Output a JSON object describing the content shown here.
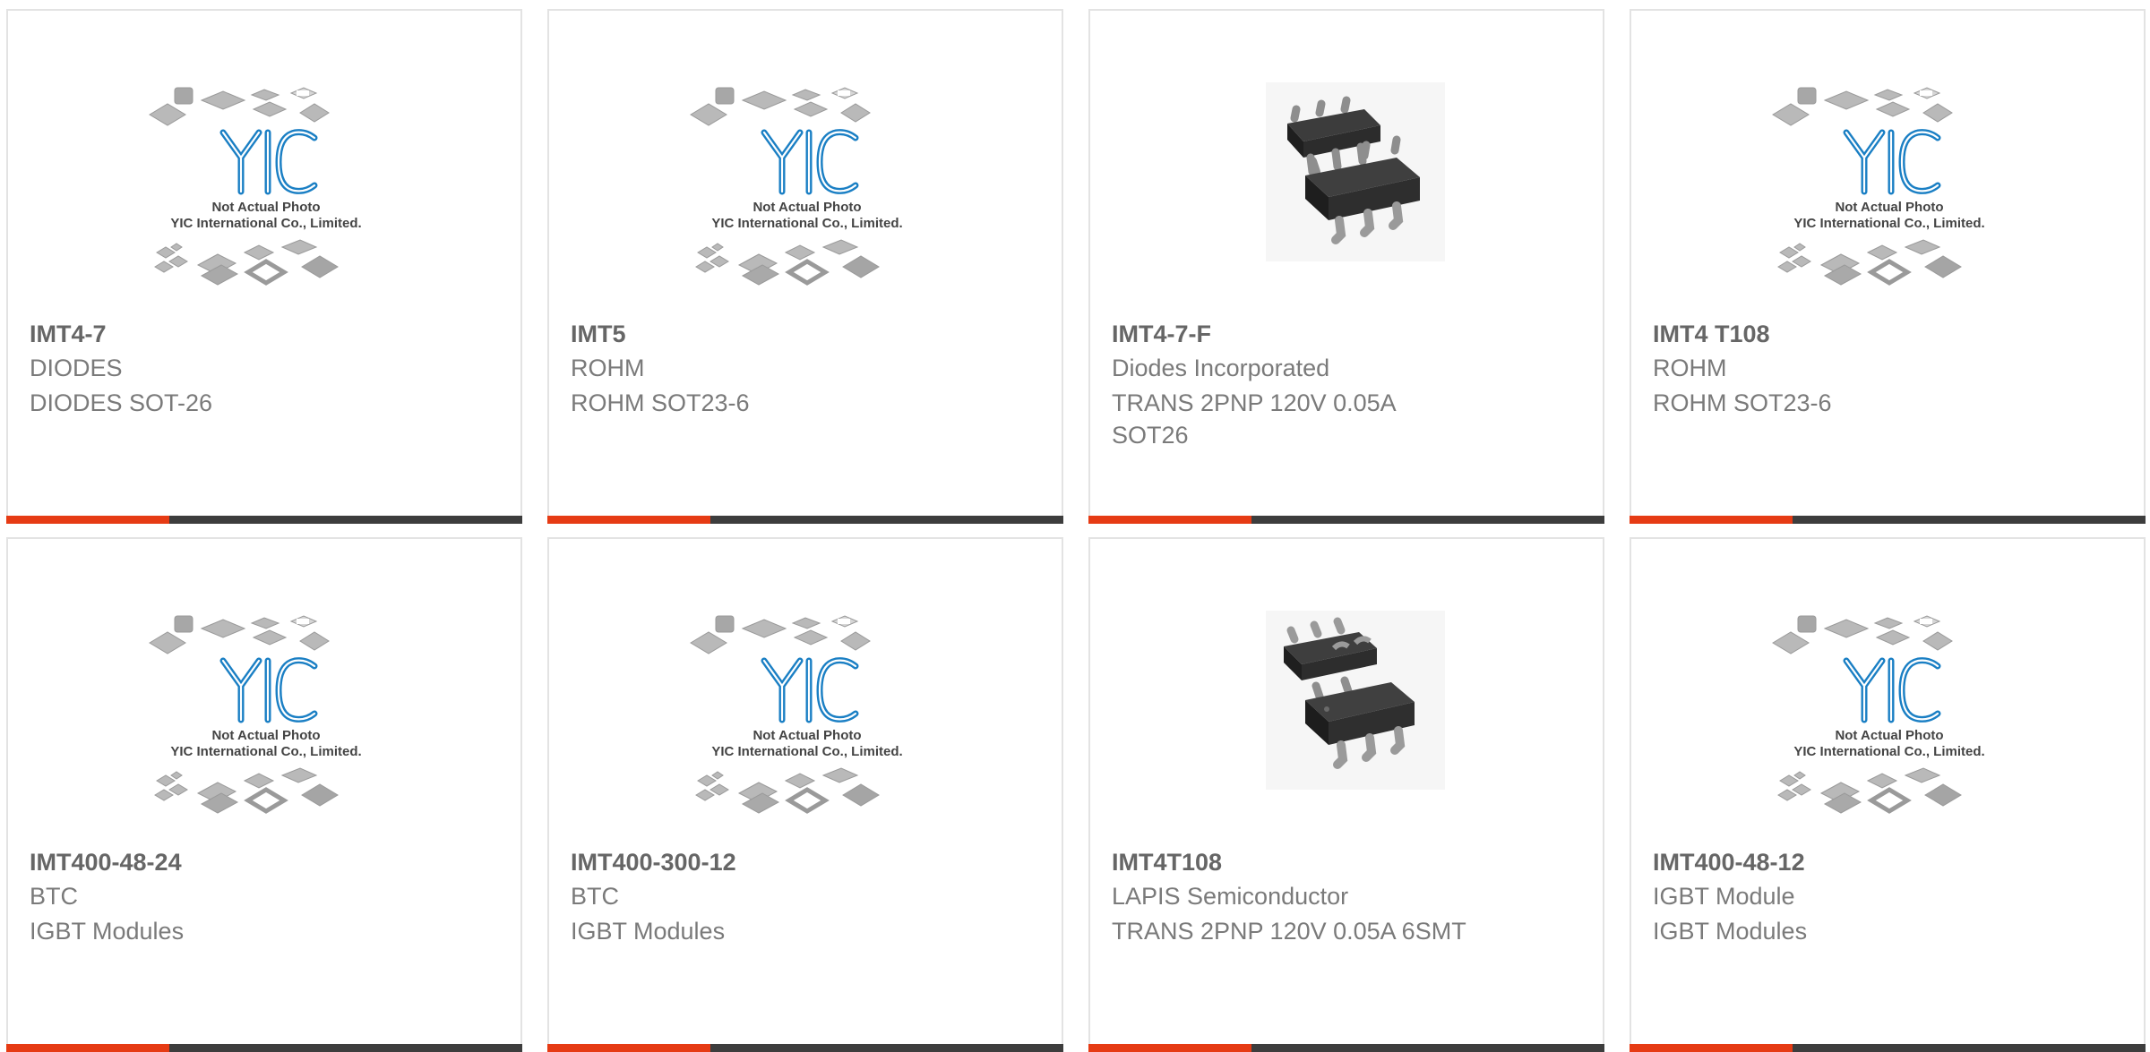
{
  "products": [
    {
      "part": "IMT4-7",
      "maker": "DIODES",
      "desc": "DIODES SOT-26",
      "photo": "placeholder"
    },
    {
      "part": "IMT5",
      "maker": "ROHM",
      "desc": "ROHM SOT23-6",
      "photo": "placeholder"
    },
    {
      "part": "IMT4-7-F",
      "maker": "Diodes Incorporated",
      "desc": "TRANS 2PNP 120V 0.05A SOT26",
      "photo": "chip"
    },
    {
      "part": "IMT4 T108",
      "maker": "ROHM",
      "desc": "ROHM SOT23-6",
      "photo": "placeholder"
    },
    {
      "part": "IMT400-48-24",
      "maker": "BTC",
      "desc": "IGBT Modules",
      "photo": "placeholder"
    },
    {
      "part": "IMT400-300-12",
      "maker": "BTC",
      "desc": "IGBT Modules",
      "photo": "placeholder"
    },
    {
      "part": "IMT4T108",
      "maker": "LAPIS Semiconductor",
      "desc": "TRANS 2PNP 120V 0.05A 6SMT",
      "photo": "chip"
    },
    {
      "part": "IMT400-48-12",
      "maker": "IGBT Module",
      "desc": "IGBT Modules",
      "photo": "placeholder"
    }
  ],
  "placeholder": {
    "brand": "YIC",
    "line1": "Not Actual Photo",
    "line2": "YIC International Co., Limited."
  },
  "colors": {
    "accent": "#e63b14",
    "bar": "#3d3d3d",
    "brand_blue": "#1a7fc4",
    "title_text": "#666666",
    "body_text": "#7a7a7a"
  }
}
